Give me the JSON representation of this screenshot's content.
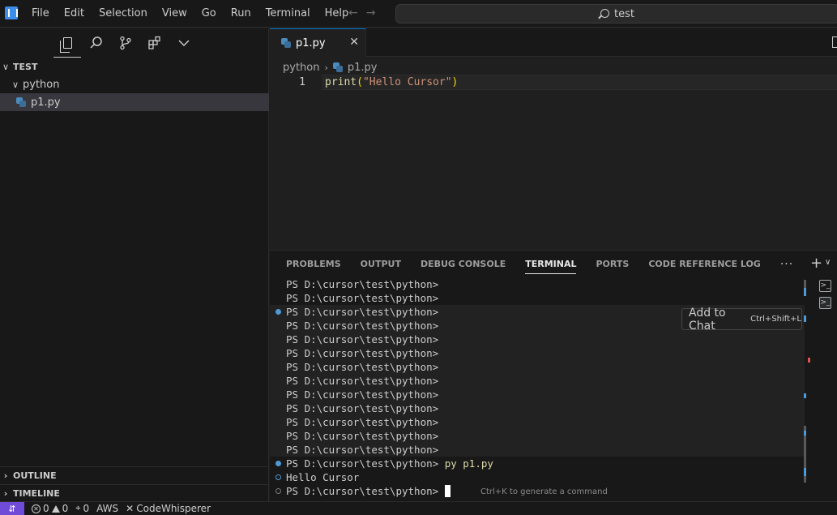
{
  "menu": [
    "File",
    "Edit",
    "Selection",
    "View",
    "Go",
    "Run",
    "Terminal",
    "Help"
  ],
  "command_center": {
    "text": "test"
  },
  "sidebar": {
    "root": "TEST",
    "folder": "python",
    "file": "p1.py",
    "outline_label": "OUTLINE",
    "timeline_label": "TIMELINE"
  },
  "editor": {
    "tab_label": "p1.py",
    "breadcrumb_folder": "python",
    "breadcrumb_file": "p1.py",
    "line_number": "1",
    "code_fn": "print",
    "code_open": "(",
    "code_str": "\"Hello Cursor\"",
    "code_close": ")"
  },
  "panel": {
    "tabs": [
      "PROBLEMS",
      "OUTPUT",
      "DEBUG CONSOLE",
      "TERMINAL",
      "PORTS",
      "CODE REFERENCE LOG"
    ],
    "active_tab": "TERMINAL",
    "prompt": "PS D:\\cursor\\test\\python>",
    "command": "py p1.py",
    "output": "Hello Cursor",
    "hint": "Ctrl+K to generate a command",
    "tooltip_main": "Add to Chat",
    "tooltip_kbd": "Ctrl+Shift+L"
  },
  "status": {
    "errors": "0",
    "warnings": "0",
    "ports": "0",
    "aws": "AWS",
    "codewhisperer": "CodeWhisperer"
  }
}
